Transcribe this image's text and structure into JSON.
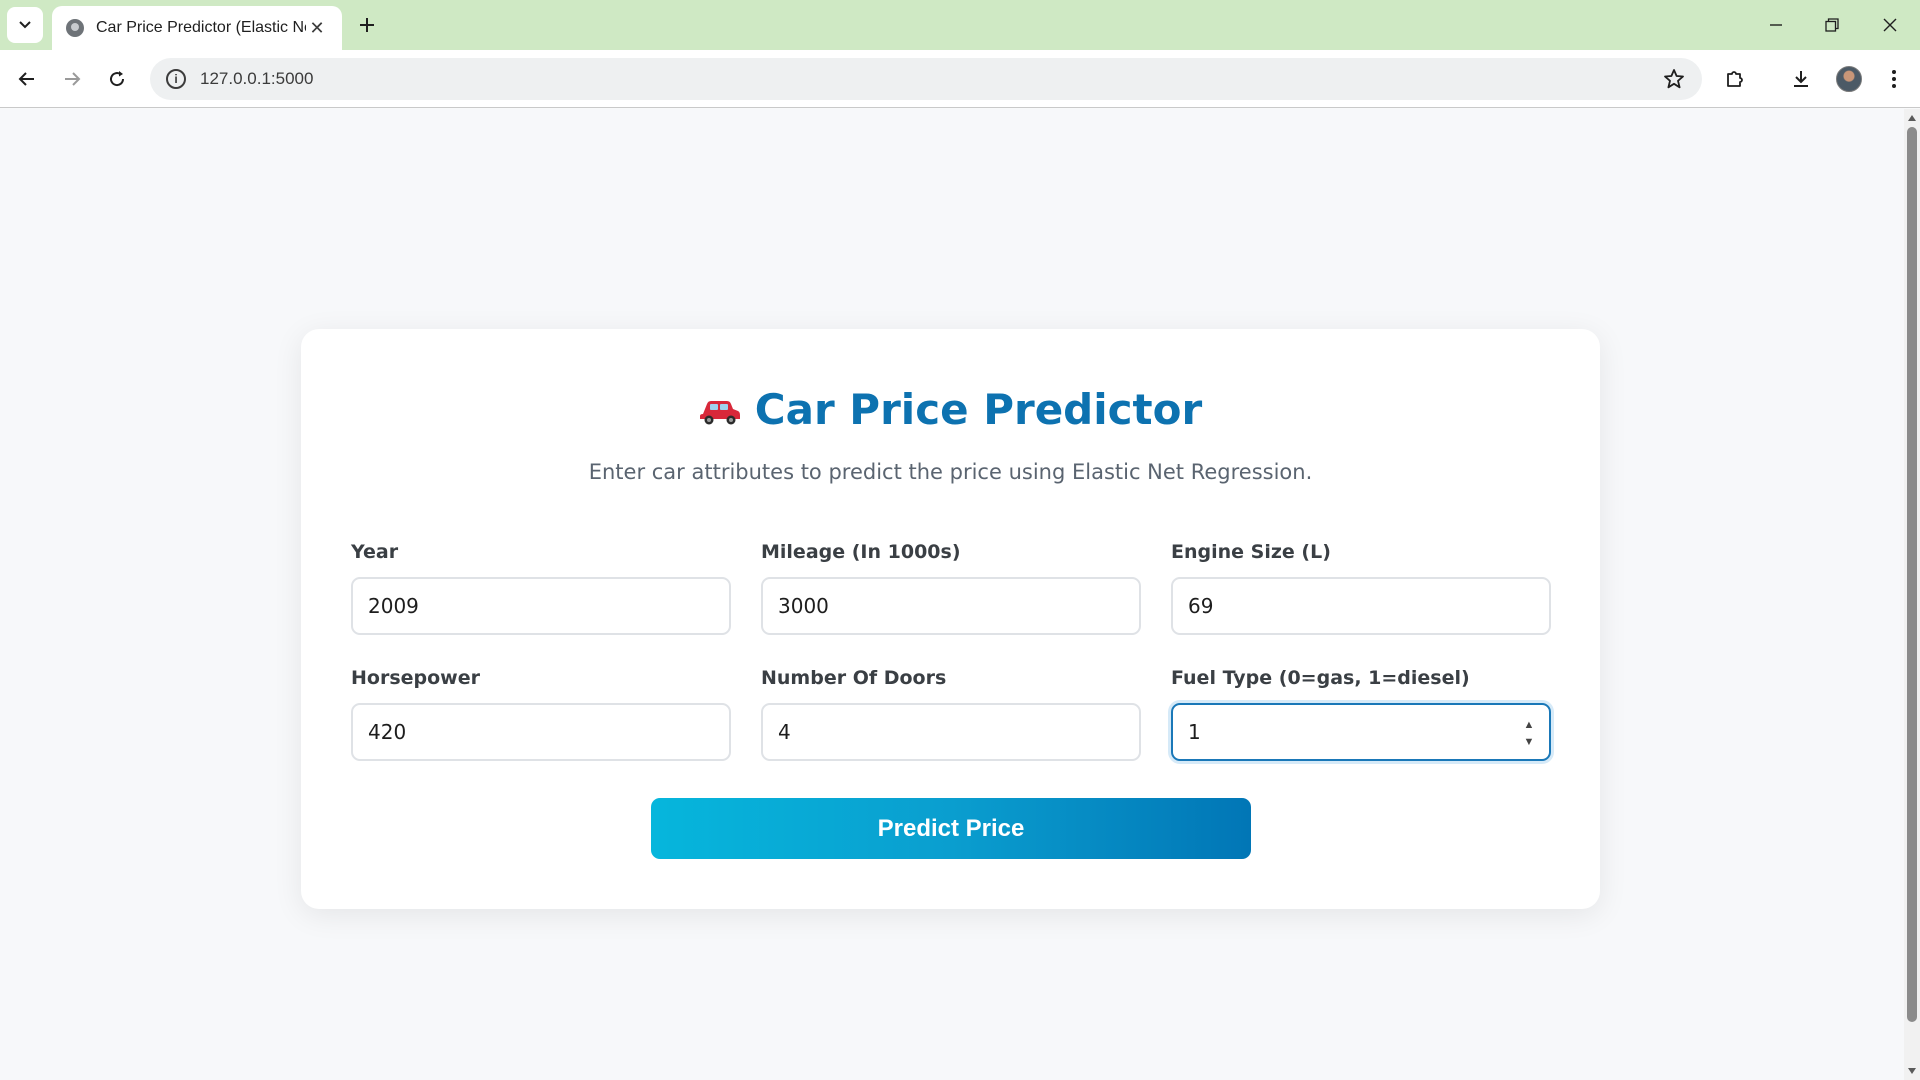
{
  "browser": {
    "tab_title": "Car Price Predictor (Elastic Net)",
    "url": "127.0.0.1:5000"
  },
  "page": {
    "title": "Car Price Predictor",
    "subtitle": "Enter car attributes to predict the price using Elastic Net Regression.",
    "fields": [
      {
        "label": "Year",
        "value": "2009"
      },
      {
        "label": "Mileage (In 1000s)",
        "value": "3000"
      },
      {
        "label": "Engine Size (L)",
        "value": "69"
      },
      {
        "label": "Horsepower",
        "value": "420"
      },
      {
        "label": "Number Of Doors",
        "value": "4"
      },
      {
        "label": "Fuel Type (0=gas, 1=diesel)",
        "value": "1"
      }
    ],
    "submit_label": "Predict Price"
  },
  "colors": {
    "title": "#0d72b0",
    "button_start": "#06b6dc",
    "button_end": "#0176b6",
    "tabbar": "#cfe9c4"
  }
}
